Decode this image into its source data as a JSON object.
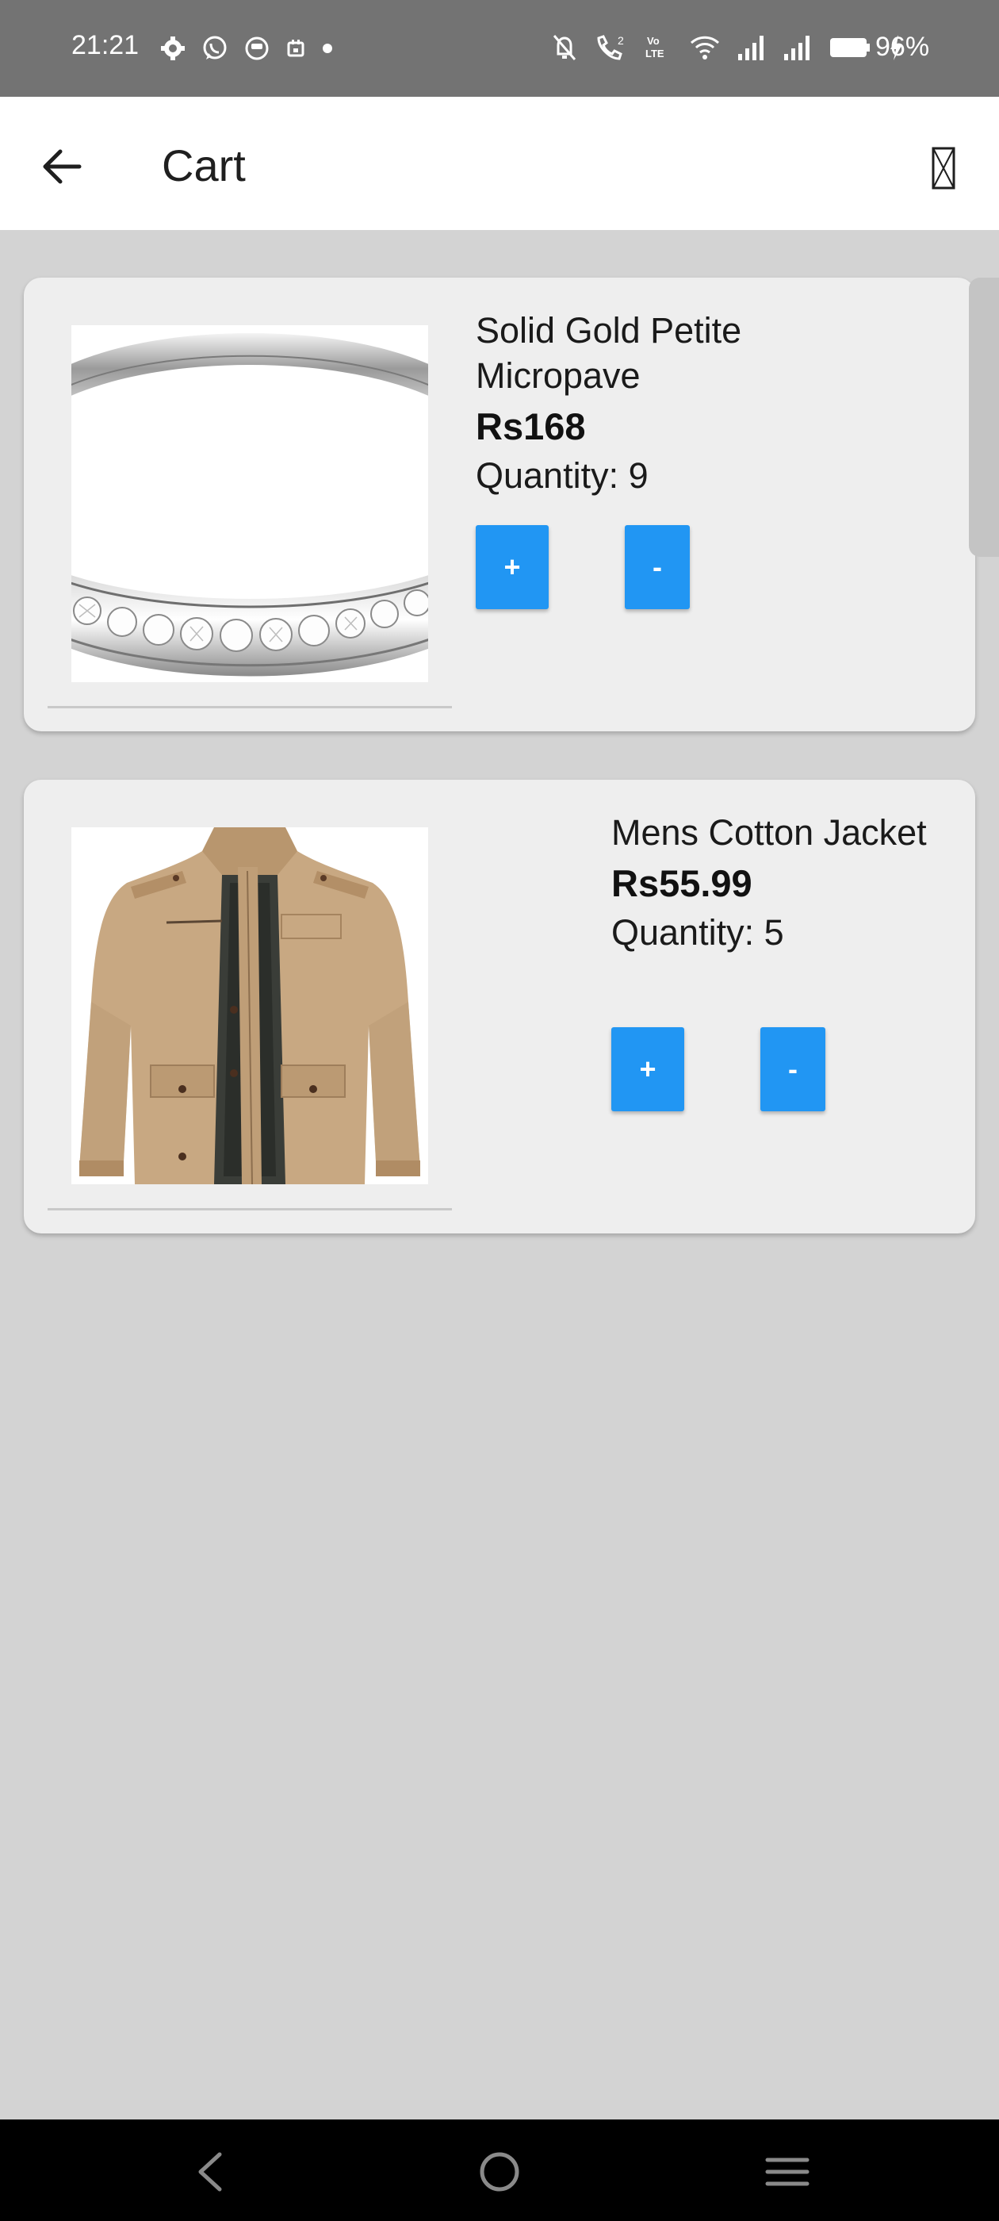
{
  "status_bar": {
    "time": "21:21",
    "battery": "96%",
    "left_icons": [
      "settings-icon",
      "whatsapp-icon",
      "app-icon",
      "calendar-icon",
      "dot-icon"
    ],
    "right_icons": [
      "mute-icon",
      "wifi-calling-icon",
      "volte-icon",
      "wifi-icon",
      "signal-icon",
      "signal-icon",
      "battery-icon",
      "charging-icon"
    ]
  },
  "app_bar": {
    "title": "Cart",
    "back_icon": "arrow-left-icon",
    "action_icon": "missing-glyph-icon"
  },
  "cart": {
    "items": [
      {
        "name": "Solid Gold Petite Micropave",
        "price": "Rs168",
        "quantity_label": "Quantity: 9",
        "plus_label": "+",
        "minus_label": "-",
        "image": "ring-image"
      },
      {
        "name": "Mens Cotton Jacket",
        "price": "Rs55.99",
        "quantity_label": "Quantity: 5",
        "plus_label": "+",
        "minus_label": "-",
        "image": "jacket-image"
      }
    ]
  },
  "colors": {
    "accent": "#2196f3",
    "background": "#d3d3d3",
    "card": "#eeeeee",
    "status_bar": "#737373",
    "nav_bar": "#000000"
  },
  "nav_bar": {
    "icons": [
      "nav-back-icon",
      "nav-home-icon",
      "nav-recents-icon"
    ]
  }
}
